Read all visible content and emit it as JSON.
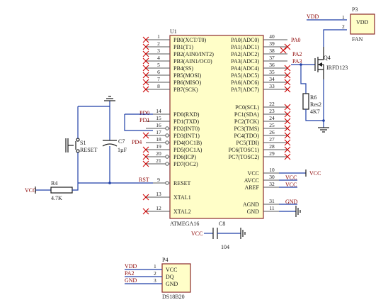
{
  "u1": {
    "designator": "U1",
    "part": "ATMEGA16",
    "left_pins": [
      {
        "num": "1",
        "name": "PB0(XCT/T0)"
      },
      {
        "num": "2",
        "name": "PB1(T1)"
      },
      {
        "num": "3",
        "name": "PB2(AIN0/INT2)"
      },
      {
        "num": "4",
        "name": "PB3(AIN1/OC0)"
      },
      {
        "num": "5",
        "name": "PB4(SS)"
      },
      {
        "num": "6",
        "name": "PB5(MOSI)"
      },
      {
        "num": "7",
        "name": "PB6(MISO)"
      },
      {
        "num": "8",
        "name": "PB7(SCK)"
      },
      {
        "num": "14",
        "name": "PD0(RXD)"
      },
      {
        "num": "15",
        "name": "PD1(TXD)"
      },
      {
        "num": "16",
        "name": "PD2(INT0)"
      },
      {
        "num": "17",
        "name": "PD3(INT1)"
      },
      {
        "num": "18",
        "name": "PD4(OC1B)"
      },
      {
        "num": "19",
        "name": "PD5(OC1A)"
      },
      {
        "num": "20",
        "name": "PD6(ICP)"
      },
      {
        "num": "21",
        "name": "PD7(OC2)"
      },
      {
        "num": "9",
        "name": "RESET"
      },
      {
        "num": "13",
        "name": "XTAL1"
      },
      {
        "num": "12",
        "name": "XTAL2"
      }
    ],
    "right_pins": [
      {
        "num": "40",
        "name": "PA0(ADC0)"
      },
      {
        "num": "39",
        "name": "PA1(ADC1)"
      },
      {
        "num": "38",
        "name": "PA2(ADC2)"
      },
      {
        "num": "37",
        "name": "PA3(ADC3)"
      },
      {
        "num": "36",
        "name": "PA4(ADC4)"
      },
      {
        "num": "35",
        "name": "PA5(ADC5)"
      },
      {
        "num": "34",
        "name": "PA6(ADC6)"
      },
      {
        "num": "33",
        "name": "PA7(ADC7)"
      },
      {
        "num": "22",
        "name": "PC0(SCL)"
      },
      {
        "num": "23",
        "name": "PC1(SDA)"
      },
      {
        "num": "24",
        "name": "PC2(TCK)"
      },
      {
        "num": "25",
        "name": "PC3(TMS)"
      },
      {
        "num": "26",
        "name": "PC4(TDO)"
      },
      {
        "num": "27",
        "name": "PC5(TDI)"
      },
      {
        "num": "28",
        "name": "PC6(TOSC1)"
      },
      {
        "num": "29",
        "name": "PC7(TOSC2)"
      },
      {
        "num": "10",
        "name": "VCC"
      },
      {
        "num": "30",
        "name": "AVCC"
      },
      {
        "num": "32",
        "name": "AREF"
      },
      {
        "num": "31",
        "name": "AGND"
      },
      {
        "num": "11",
        "name": "GND"
      }
    ]
  },
  "nets": {
    "pa0": "PA0",
    "pa2": "PA2",
    "pa3": "PA3",
    "pd0": "PD0",
    "pd1": "PD1",
    "pd4": "PD4",
    "rst": "RST",
    "vcc": "VCC",
    "vdd": "VDD",
    "gnd": "GND"
  },
  "p3": {
    "designator": "P3",
    "body_label": "VDD",
    "name": "FAN",
    "pin1": "1",
    "pin2": "2"
  },
  "q4": {
    "designator": "Q4",
    "part": "IRFD123"
  },
  "r6": {
    "designator": "R6",
    "type": "Res2",
    "value": "4K7"
  },
  "r4": {
    "designator": "R4",
    "value": "4.7K"
  },
  "s1": {
    "designator": "S1",
    "name": "RESET"
  },
  "c7": {
    "designator": "C7",
    "value": "1µF"
  },
  "c8": {
    "designator": "C8",
    "value": "104"
  },
  "p4": {
    "designator": "P4",
    "part": "DS18B20",
    "pins": [
      {
        "num": "1",
        "name": "VCC"
      },
      {
        "num": "2",
        "name": "DQ"
      },
      {
        "num": "3",
        "name": "GND"
      }
    ]
  },
  "colors": {
    "wire": "#1f3fa6",
    "body_fill": "#fffec8",
    "body_stroke": "#8b2b2b",
    "net_label": "#8b0000",
    "no_connect": "#cc0000"
  }
}
